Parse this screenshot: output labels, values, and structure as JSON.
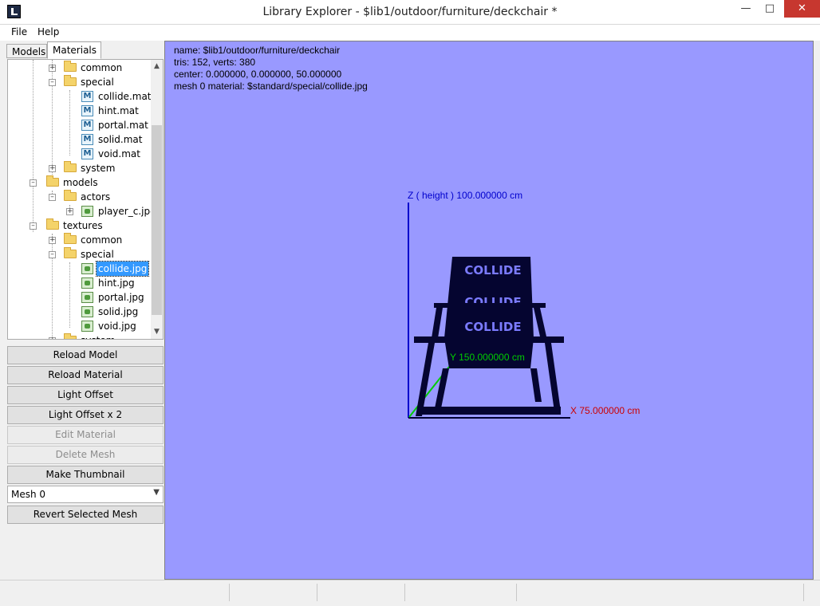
{
  "window": {
    "title": "Library Explorer - $lib1/outdoor/furniture/deckchair *",
    "minimize_icon": "minimize-icon",
    "maximize_icon": "maximize-icon",
    "close_icon": "close-icon"
  },
  "menu": {
    "file": "File",
    "help": "Help"
  },
  "tabs": {
    "models": "Models",
    "materials": "Materials"
  },
  "tree": {
    "items": [
      {
        "label": "common",
        "icon": "folder"
      },
      {
        "label": "special",
        "icon": "folder"
      },
      {
        "label": "collide.mat",
        "icon": "material"
      },
      {
        "label": "hint.mat",
        "icon": "material"
      },
      {
        "label": "portal.mat",
        "icon": "material"
      },
      {
        "label": "solid.mat",
        "icon": "material"
      },
      {
        "label": "void.mat",
        "icon": "material"
      },
      {
        "label": "system",
        "icon": "folder"
      },
      {
        "label": "models",
        "icon": "folder"
      },
      {
        "label": "actors",
        "icon": "folder"
      },
      {
        "label": "player_c.jpg",
        "icon": "image"
      },
      {
        "label": "textures",
        "icon": "folder"
      },
      {
        "label": "common",
        "icon": "folder"
      },
      {
        "label": "special",
        "icon": "folder"
      },
      {
        "label": "collide.jpg",
        "icon": "image",
        "selected": true
      },
      {
        "label": "hint.jpg",
        "icon": "image"
      },
      {
        "label": "portal.jpg",
        "icon": "image"
      },
      {
        "label": "solid.jpg",
        "icon": "image"
      },
      {
        "label": "void.jpg",
        "icon": "image"
      },
      {
        "label": "system",
        "icon": "folder"
      }
    ]
  },
  "buttons": {
    "reload_model": "Reload Model",
    "reload_material": "Reload Material",
    "light_offset": "Light Offset",
    "light_offset_x2": "Light Offset x 2",
    "edit_material": "Edit Material",
    "delete_mesh": "Delete Mesh",
    "make_thumbnail": "Make Thumbnail",
    "revert_selected_mesh": "Revert Selected Mesh"
  },
  "mesh_select": {
    "value": "Mesh 0"
  },
  "viewport": {
    "info": {
      "name": "name: $lib1/outdoor/furniture/deckchair",
      "tris": "tris: 152, verts: 380",
      "center": "center: 0.000000, 0.000000, 50.000000",
      "material": "mesh 0 material: $standard/special/collide.jpg"
    },
    "axes": {
      "z": "Z ( height ) 100.000000 cm",
      "y": "Y 150.000000 cm",
      "x": "X 75.000000 cm"
    },
    "texture_text": "COLLIDE",
    "colors": {
      "background": "#9999ff",
      "z_axis": "#0000cc",
      "y_axis": "#00cc00",
      "x_axis": "#cc0000",
      "model": "#050530"
    }
  }
}
